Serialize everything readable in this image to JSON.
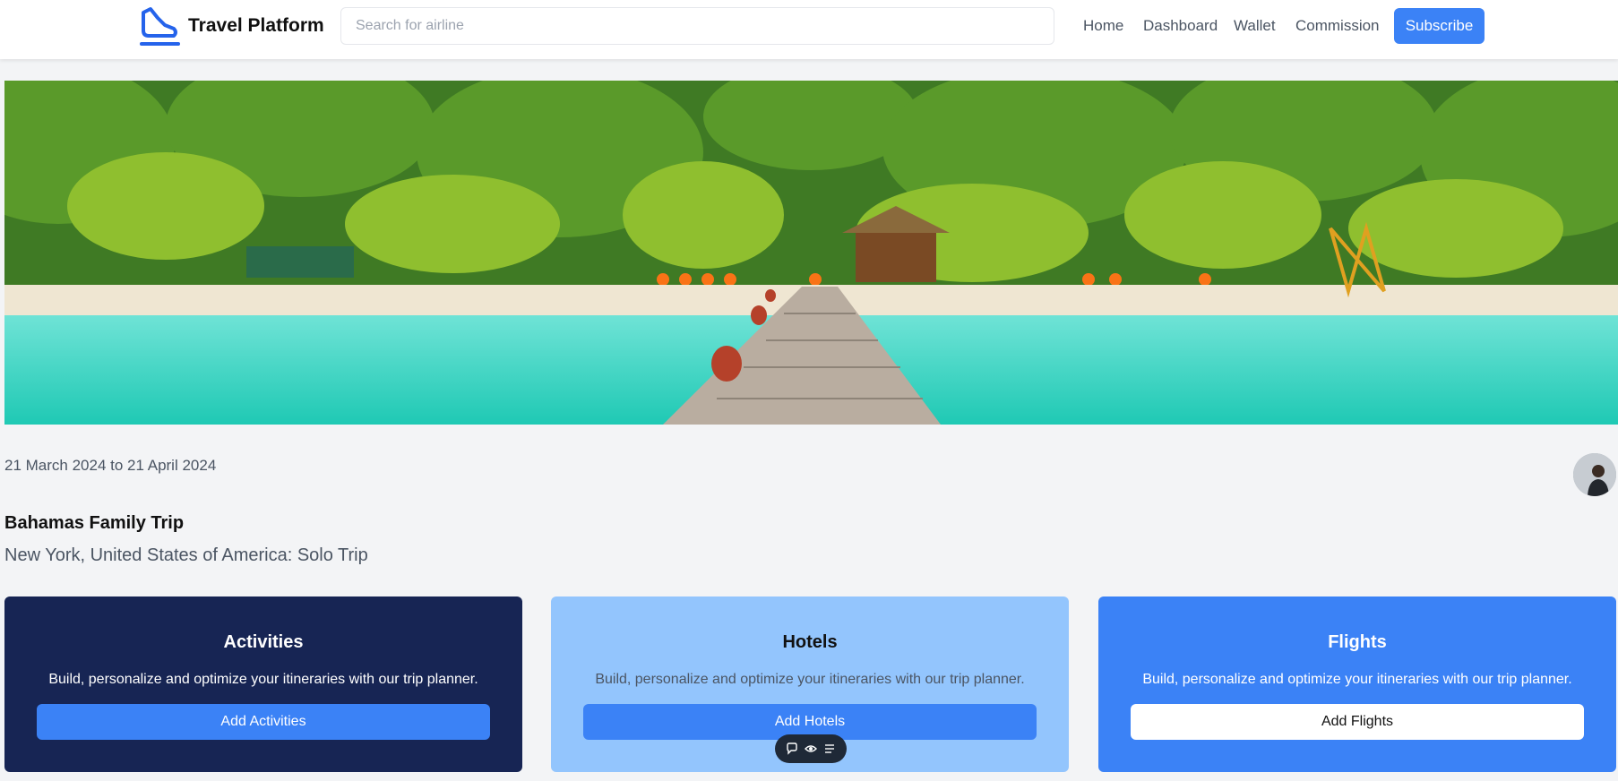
{
  "header": {
    "brand": "Travel Platform",
    "search_placeholder": "Search for airline",
    "nav": [
      "Home",
      "Dashboard",
      "Wallet",
      "Commission"
    ],
    "subscribe_label": "Subscribe",
    "accent_color": "#3b82f6"
  },
  "hero": {
    "icon": "beach-banner-image"
  },
  "trip": {
    "dates": "21 March 2024 to 21 April 2024",
    "title": "Bahamas Family Trip",
    "subtitle": "New York, United States of America: Solo Trip"
  },
  "cards": [
    {
      "title": "Activities",
      "description": "Build, personalize and optimize your itineraries with our trip planner.",
      "button": "Add Activities",
      "bg_color": "#172554"
    },
    {
      "title": "Hotels",
      "description": "Build, personalize and optimize your itineraries with our trip planner.",
      "button": "Add Hotels",
      "bg_color": "#93c5fd"
    },
    {
      "title": "Flights",
      "description": "Build, personalize and optimize your itineraries with our trip planner.",
      "button": "Add Flights",
      "bg_color": "#3b82f6"
    }
  ],
  "floating_toolbar": {
    "icons": [
      "comment-icon",
      "eye-icon",
      "list-settings-icon"
    ]
  }
}
